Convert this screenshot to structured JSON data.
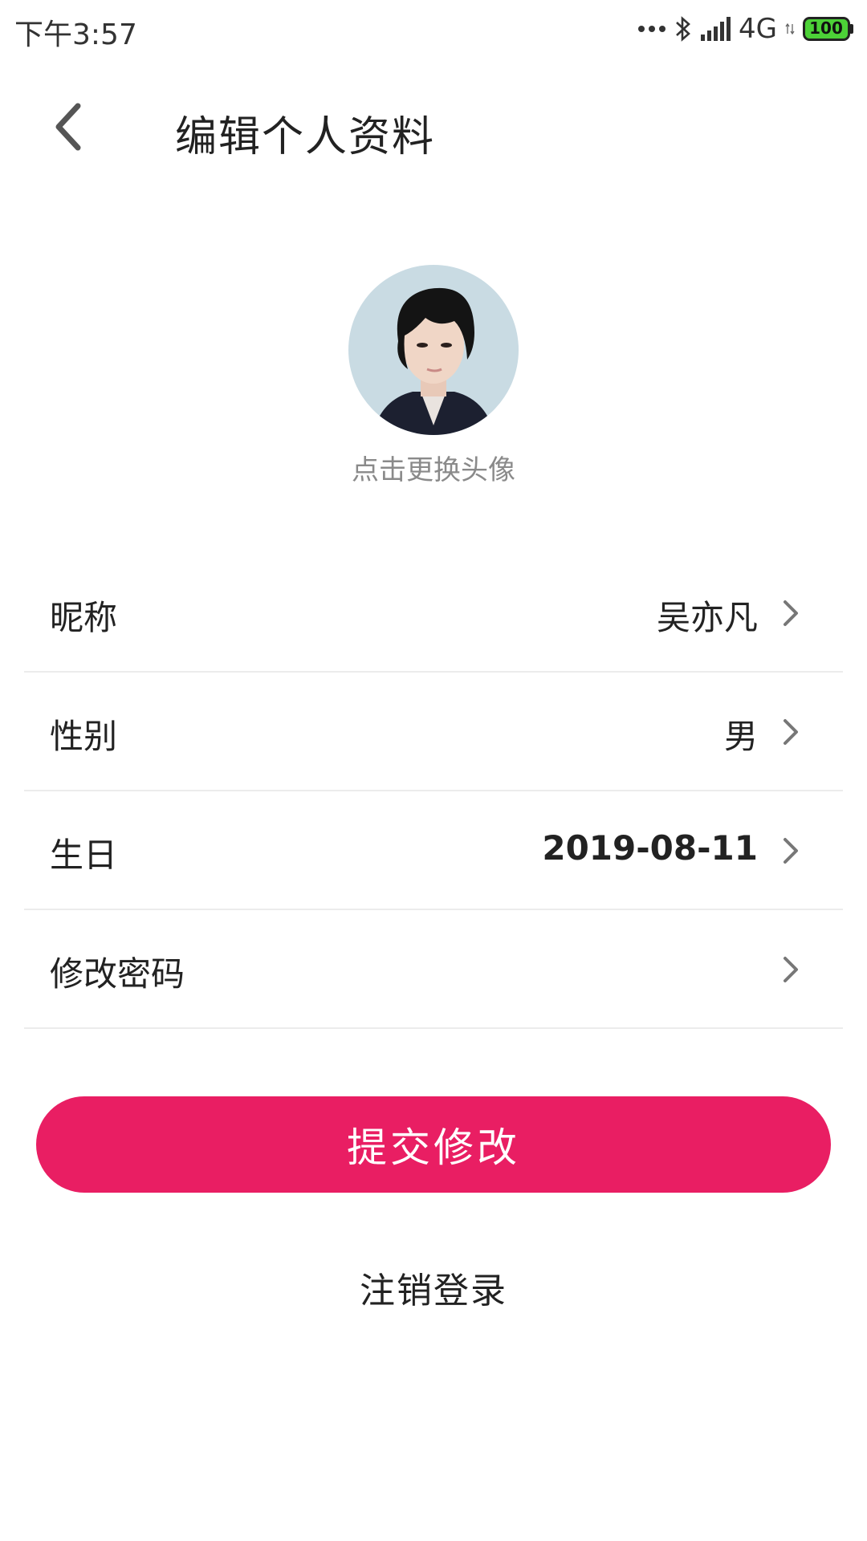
{
  "status_bar": {
    "time": "下午3:57",
    "network": "4G",
    "battery": "100",
    "battery_color": "#4cd137"
  },
  "header": {
    "title": "编辑个人资料",
    "back_icon": "chevron-left-icon"
  },
  "avatar": {
    "hint": "点击更换头像"
  },
  "fields": [
    {
      "label": "昵称",
      "value": "吴亦凡"
    },
    {
      "label": "性别",
      "value": "男"
    },
    {
      "label": "生日",
      "value": "2019-08-11"
    },
    {
      "label": "修改密码",
      "value": ""
    }
  ],
  "actions": {
    "submit_label": "提交修改",
    "logout_label": "注销登录"
  },
  "colors": {
    "accent": "#e91e63",
    "divider": "#ececec",
    "hint_text": "#8a8a8a"
  }
}
